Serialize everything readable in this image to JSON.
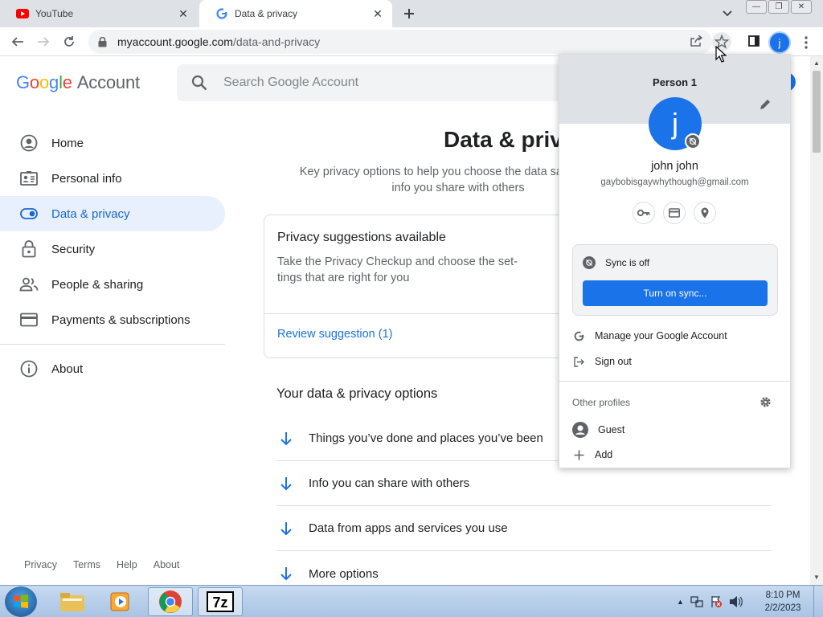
{
  "browser": {
    "tabs": [
      {
        "title": "YouTube",
        "favicon": "youtube-icon",
        "active": false
      },
      {
        "title": "Data & privacy",
        "favicon": "google-g-icon",
        "active": true
      }
    ],
    "address": {
      "host": "myaccount.google.com",
      "path": "/data-and-privacy"
    },
    "profile_initial": "j"
  },
  "page": {
    "logo": {
      "google": "Google",
      "account": "Account"
    },
    "search": {
      "placeholder": "Search Google Account"
    },
    "nav": [
      {
        "label": "Home",
        "icon": "account-circle-icon"
      },
      {
        "label": "Personal info",
        "icon": "id-card-icon"
      },
      {
        "label": "Data & privacy",
        "icon": "toggle-icon",
        "active": true
      },
      {
        "label": "Security",
        "icon": "lock-icon"
      },
      {
        "label": "People & sharing",
        "icon": "people-icon"
      },
      {
        "label": "Payments & subscriptions",
        "icon": "credit-card-icon"
      },
      {
        "label": "About",
        "icon": "info-icon"
      }
    ],
    "footer": [
      "Privacy",
      "Terms",
      "Help",
      "About"
    ],
    "title": "Data & priva",
    "description": "Key privacy options to help you choose the data sav info you share with others",
    "description_line1": "Key privacy options to help you choose the data sav",
    "description_line2": "info you share with others",
    "suggestion_card": {
      "title": "Privacy suggestions available",
      "body": "Take the Privacy Checkup and choose the set-tings that are right for you",
      "body_line1": "Take the Privacy Checkup and choose the set-",
      "body_line2": "tings that are right for you",
      "link": "Review suggestion (1)"
    },
    "options_title": "Your data & privacy options",
    "options": [
      "Things you’ve done and places you’ve been",
      "Info you can share with others",
      "Data from apps and services you use",
      "More options"
    ]
  },
  "profile_menu": {
    "profile_name": "Person 1",
    "avatar_initial": "j",
    "user_name": "john john",
    "email": "gaybobisgaywhythough@gmail.com",
    "sync_status": "Sync is off",
    "sync_button": "Turn on sync...",
    "manage_account": "Manage your Google Account",
    "sign_out": "Sign out",
    "other_profiles": "Other profiles",
    "guest": "Guest",
    "add": "Add"
  },
  "taskbar": {
    "time": "8:10 PM",
    "date": "2/2/2023",
    "apps": [
      "windows-explorer-icon",
      "media-player-icon",
      "chrome-icon",
      "7zip-icon"
    ]
  },
  "colors": {
    "accent": "#1a73e8",
    "active_nav_bg": "#e8f0fe",
    "tabstrip": "#dee1e6"
  }
}
